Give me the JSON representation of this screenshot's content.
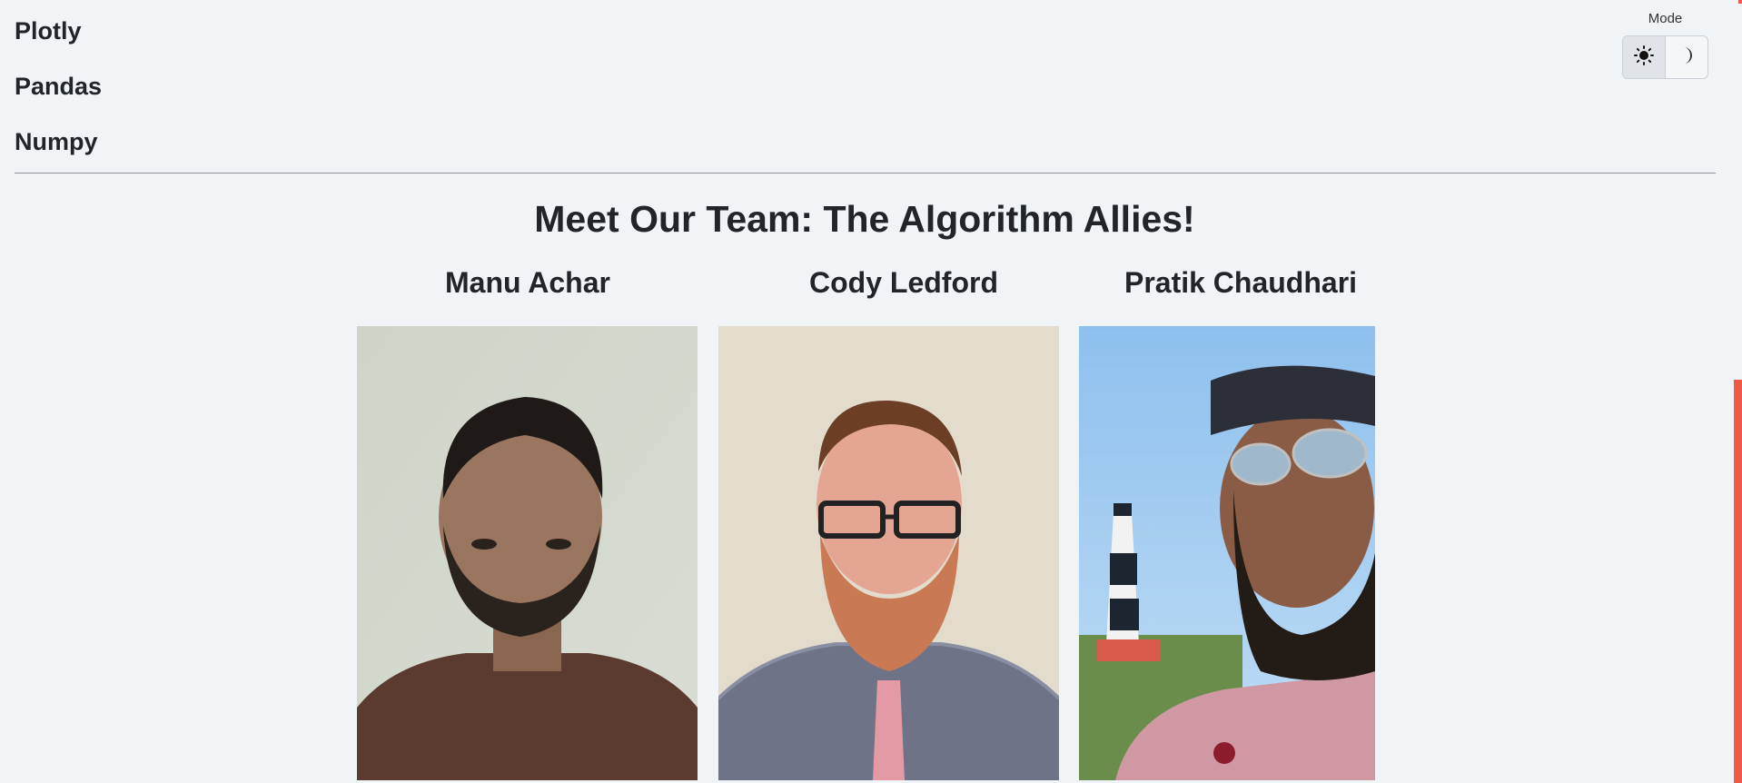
{
  "tech_list": {
    "items": [
      "Plotly",
      "Pandas",
      "Numpy"
    ]
  },
  "mode": {
    "label": "Mode",
    "options": [
      {
        "icon": "sun-icon",
        "active": true
      },
      {
        "icon": "moon-icon",
        "active": false
      }
    ]
  },
  "team": {
    "title": "Meet Our Team: The Algorithm Allies!",
    "members": [
      {
        "name": "Manu Achar",
        "photo_icon": "member-photo"
      },
      {
        "name": "Cody Ledford",
        "photo_icon": "member-photo"
      },
      {
        "name": "Pratik Chaudhari",
        "photo_icon": "member-photo"
      }
    ]
  },
  "colors": {
    "background": "#f0f4f7",
    "text": "#212529",
    "accent": "#ef5a45"
  }
}
